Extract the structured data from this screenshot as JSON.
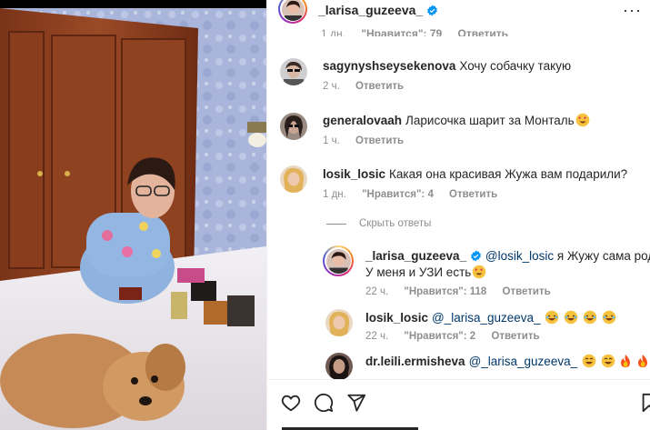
{
  "post": {
    "author": "_larisa_guzeeva_",
    "partial_row": {
      "time": "1 дн.",
      "likes": "\"Нравится\": 79",
      "reply": "Ответить"
    }
  },
  "comments": [
    {
      "user": "sagynyshseysekenova",
      "text": "Хочу собачку такую",
      "time": "2 ч.",
      "reply": "Ответить"
    },
    {
      "user": "generalovaah",
      "text": "Ларисочка шарит за Монталь",
      "time": "1 ч.",
      "reply": "Ответить"
    },
    {
      "user": "losik_losic",
      "text": "Какая она красивая Жужа вам подарили?",
      "time": "1 дн.",
      "likes": "\"Нравится\": 4",
      "reply": "Ответить"
    }
  ],
  "hide_replies": "Скрыть ответы",
  "replies": [
    {
      "user": "_larisa_guzeeva_",
      "mention": "@losik_losic",
      "text_line1": "я Жужу сама родила.",
      "text_line2": "У меня и УЗИ есть",
      "time": "22 ч.",
      "likes": "\"Нравится\": 118",
      "reply": "Ответить"
    },
    {
      "user": "losik_losic",
      "mention": "@_larisa_guzeeva_",
      "time": "22 ч.",
      "likes": "\"Нравится\": 2",
      "reply": "Ответить"
    },
    {
      "user": "dr.leili.ermisheva",
      "mention": "@_larisa_guzeeva_"
    }
  ],
  "icons": {
    "header_more": "more-horizontal-icon",
    "verified": "verified-badge-icon",
    "like": "heart-icon",
    "comment": "comment-icon",
    "share": "paper-plane-icon",
    "save": "bookmark-icon"
  },
  "colors": {
    "accent": "#0095f6",
    "mention": "#00376b",
    "muted": "#8e8e8e",
    "text": "#262626"
  }
}
